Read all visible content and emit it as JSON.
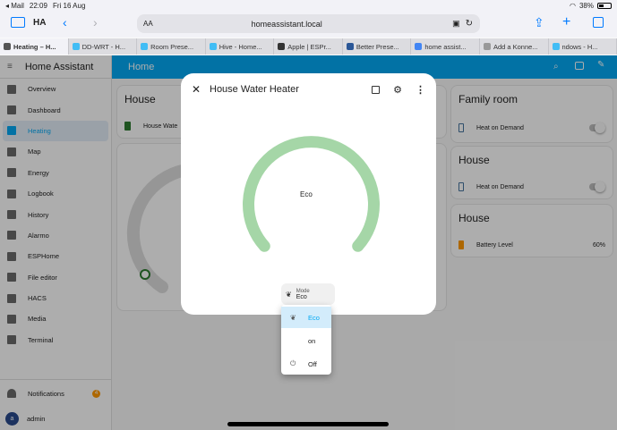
{
  "status": {
    "carrier": "◂ Mail",
    "time": "22:09",
    "date": "Fri 16 Aug",
    "battery": "38%"
  },
  "browser": {
    "tab_group": "HA",
    "url": "homeassistant.local",
    "text_size": "AA",
    "tabs": [
      {
        "label": "Heating – H...",
        "active": true,
        "fav_color": "#555"
      },
      {
        "label": "DD-WRT - H...",
        "active": false,
        "fav_color": "#41bdf5"
      },
      {
        "label": "Room Prese...",
        "active": false,
        "fav_color": "#41bdf5"
      },
      {
        "label": "Hive - Home...",
        "active": false,
        "fav_color": "#41bdf5"
      },
      {
        "label": "Apple | ESPr...",
        "active": false,
        "fav_color": "#333"
      },
      {
        "label": "Better Prese...",
        "active": false,
        "fav_color": "#2b5797"
      },
      {
        "label": "home assist...",
        "active": false,
        "fav_color": "#4285f4"
      },
      {
        "label": "Add a Konne...",
        "active": false,
        "fav_color": "#999"
      },
      {
        "label": "ndows - H...",
        "active": false,
        "fav_color": "#41bdf5"
      }
    ]
  },
  "sidebar": {
    "title": "Home Assistant",
    "items": [
      {
        "label": "Overview",
        "icon": "overview-icon"
      },
      {
        "label": "Dashboard",
        "icon": "dashboard-icon"
      },
      {
        "label": "Heating",
        "icon": "heating-icon",
        "active": true
      },
      {
        "label": "Map",
        "icon": "map-icon"
      },
      {
        "label": "Energy",
        "icon": "energy-icon"
      },
      {
        "label": "Logbook",
        "icon": "logbook-icon"
      },
      {
        "label": "History",
        "icon": "history-icon"
      },
      {
        "label": "Alarmo",
        "icon": "shield-icon"
      },
      {
        "label": "ESPHome",
        "icon": "esphome-icon"
      },
      {
        "label": "File editor",
        "icon": "wrench-icon"
      },
      {
        "label": "HACS",
        "icon": "hacs-icon"
      },
      {
        "label": "Media",
        "icon": "media-icon"
      },
      {
        "label": "Terminal",
        "icon": "terminal-icon"
      }
    ],
    "notifications": {
      "label": "Notifications",
      "count": "4"
    },
    "user": {
      "initial": "a",
      "label": "admin"
    }
  },
  "header": {
    "title": "Home"
  },
  "cards": {
    "house_water": {
      "title": "House",
      "entity": "House Wate"
    },
    "family_room": {
      "title": "Family room",
      "entity": "Heat on Demand"
    },
    "house_heat": {
      "title": "House",
      "entity": "Heat on Demand"
    },
    "house_battery": {
      "title": "House",
      "entity": "Battery Level",
      "value": "60%"
    }
  },
  "dialog": {
    "title": "House Water Heater",
    "gauge_label": "Eco",
    "gauge_color": "#a5d6a7",
    "mode_label": "Mode",
    "mode_value": "Eco",
    "menu": [
      {
        "label": "Eco",
        "icon": "leaf-icon",
        "selected": true
      },
      {
        "label": "on",
        "icon": "",
        "selected": false
      },
      {
        "label": "Off",
        "icon": "power-icon",
        "selected": false
      }
    ]
  }
}
